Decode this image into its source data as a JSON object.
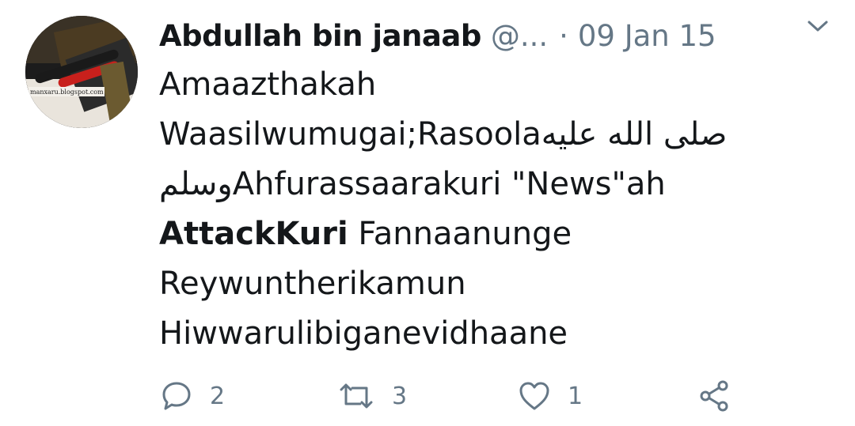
{
  "tweet": {
    "author_name": "Abdullah bin janaab",
    "handle": "@...",
    "separator": "·",
    "date": "09 Jan 15",
    "avatar_watermark": "manxaru.blogspot.com",
    "body_lines": [
      {
        "text": "Amaazthakah",
        "bold": false
      },
      {
        "text": "Waasilwumugai;Rasoolaصلى الله عليه",
        "bold": false
      },
      {
        "text": "وسلمAhfurassaarakuri \"News\"ah",
        "bold": false
      }
    ],
    "line4_bold": "AttackKuri",
    "line4_rest": " Fannaanunge",
    "line5": "Reywuntherikamun",
    "line6": "Hiwwarulibiganevidhaane"
  },
  "actions": {
    "reply_count": "2",
    "retweet_count": "3",
    "like_count": "1"
  },
  "icons": {
    "caret": "chevron-down-icon",
    "reply": "reply-icon",
    "retweet": "retweet-icon",
    "like": "heart-icon",
    "share": "share-icon"
  },
  "colors": {
    "text": "#14171a",
    "muted": "#657786",
    "icon": "#657786"
  }
}
